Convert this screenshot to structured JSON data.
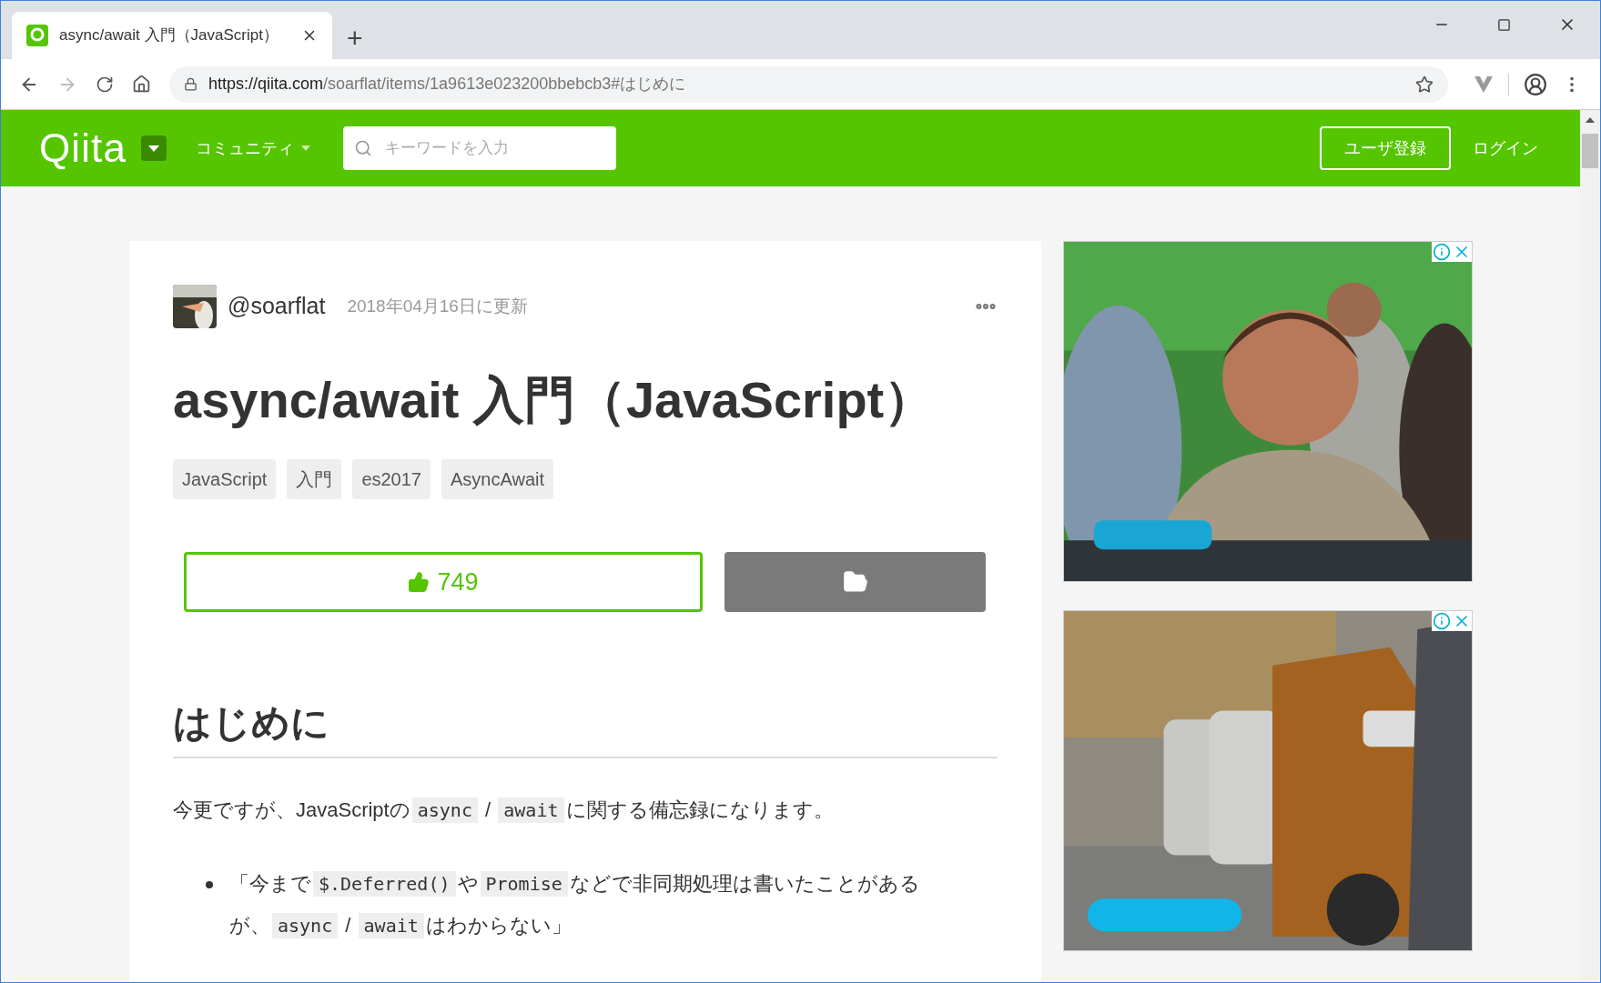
{
  "browser": {
    "tab": {
      "title": "async/await 入門（JavaScript）",
      "selected": true
    },
    "new_tab": "+",
    "url": {
      "host": "https://qiita.com",
      "path": "/soarflat/items/1a9613e023200bbebcb3#はじめに"
    }
  },
  "site_header": {
    "logo": "Qiita",
    "menu": "コミュニティ",
    "search": {
      "placeholder": "キーワードを入力"
    },
    "signup": "ユーザ登録",
    "login": "ログイン"
  },
  "article": {
    "author": "@soarflat",
    "updated": "2018年04月16日に更新",
    "title": "async/await 入門（JavaScript）",
    "tags": [
      "JavaScript",
      "入門",
      "es2017",
      "AsyncAwait"
    ],
    "likes": "749",
    "section_heading": "はじめに",
    "intro": [
      {
        "kind": "text",
        "text": "今更ですが、JavaScriptの"
      },
      {
        "kind": "code",
        "text": "async"
      },
      {
        "kind": "text",
        "text": " / "
      },
      {
        "kind": "code",
        "text": "await"
      },
      {
        "kind": "text",
        "text": "に関する備忘録になります。"
      }
    ],
    "bullets": [
      [
        {
          "kind": "text",
          "text": "「今まで"
        },
        {
          "kind": "code",
          "text": "$.Deferred()"
        },
        {
          "kind": "text",
          "text": "や"
        },
        {
          "kind": "code",
          "text": "Promise"
        },
        {
          "kind": "text",
          "text": "などで非同期処理は書いたことがあるが、"
        },
        {
          "kind": "code",
          "text": "async"
        },
        {
          "kind": "text",
          "text": " / "
        },
        {
          "kind": "code",
          "text": "await"
        },
        {
          "kind": "text",
          "text": "はわからない」"
        }
      ]
    ]
  }
}
